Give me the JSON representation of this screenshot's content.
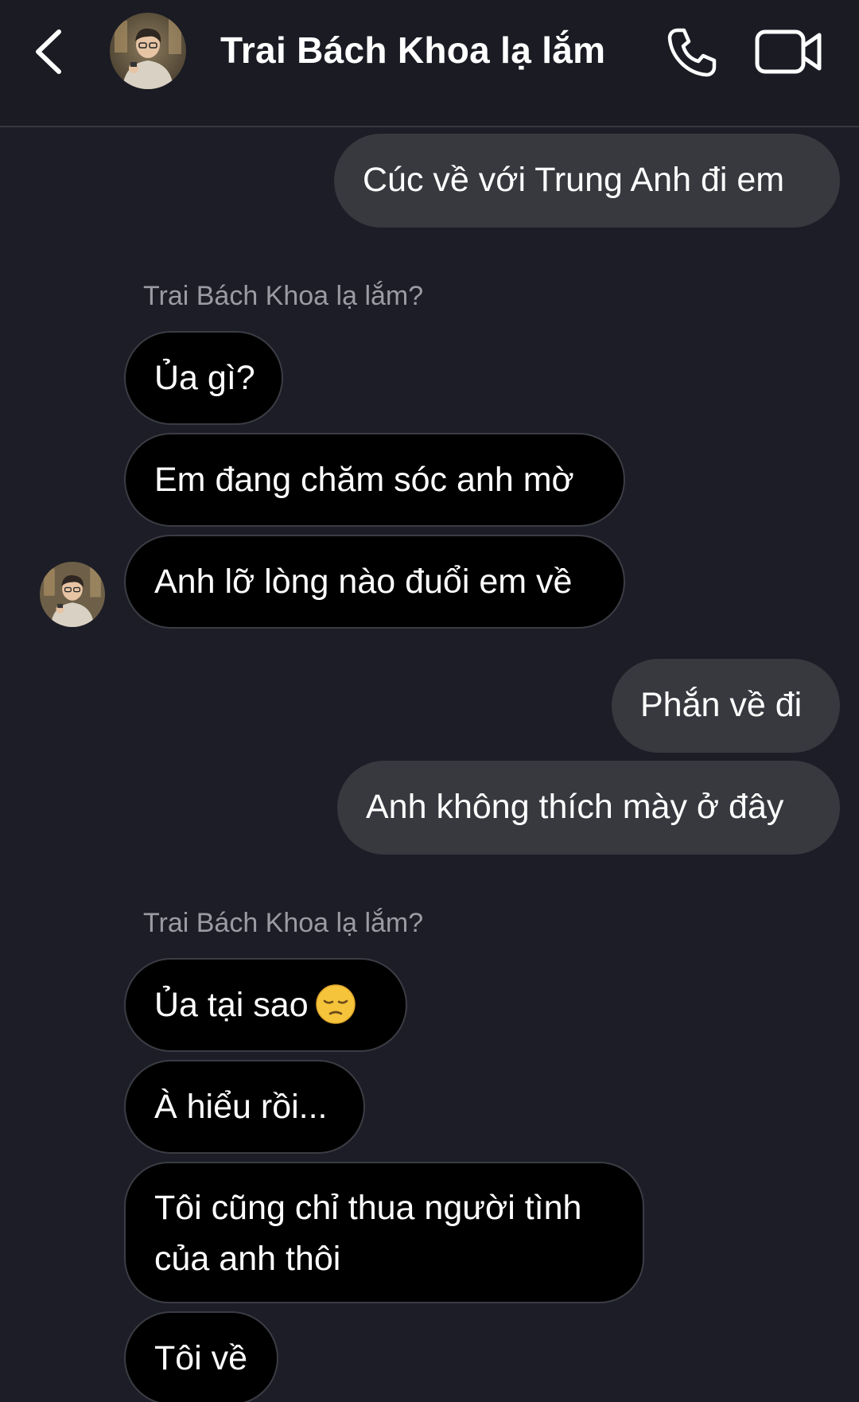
{
  "header": {
    "contact_name": "Trai Bách Khoa lạ lắm",
    "back_icon": "chevron-left-icon",
    "call_icon": "phone-icon",
    "video_icon": "video-camera-icon"
  },
  "colors": {
    "background": "#1c1d26",
    "outgoing_bubble": "#38393f",
    "incoming_bubble": "#000000",
    "incoming_border": "#3b3c44",
    "text": "#ffffff",
    "sender_label": "#9a9ba3"
  },
  "messages": {
    "m1": "Cúc về với Trung Anh đi em",
    "sender_label_1": "Trai Bách Khoa lạ lắm?",
    "m2": "Ủa gì?",
    "m3": "Em đang chăm sóc anh mờ",
    "m4": "Anh lỡ lòng nào đuổi em về",
    "m5": "Phắn về đi",
    "m6": "Anh không thích mày ở đây",
    "sender_label_2": "Trai Bách Khoa lạ lắm?",
    "m7": "Ủa tại sao",
    "m7_emoji": "pensive-face-emoji",
    "m8": "À hiểu rồi...",
    "m9": "Tôi cũng chỉ thua người tình của anh thôi",
    "m10": "Tôi về"
  }
}
